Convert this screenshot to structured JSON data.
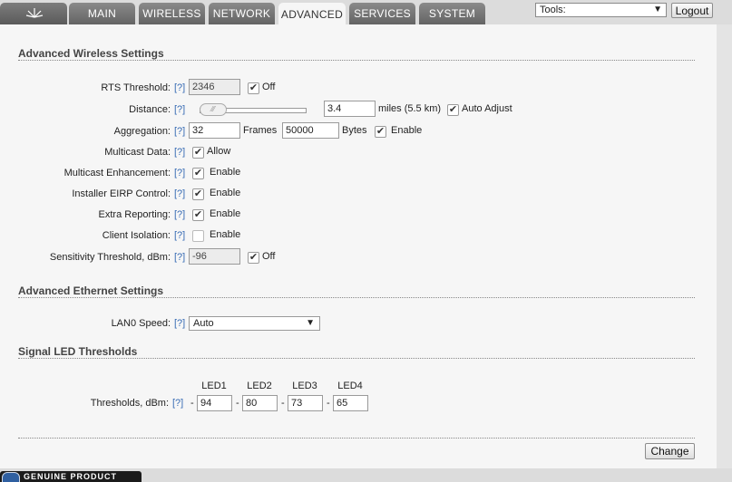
{
  "nav": {
    "tabs": [
      {
        "label": "MAIN"
      },
      {
        "label": "WIRELESS"
      },
      {
        "label": "NETWORK"
      },
      {
        "label": "ADVANCED"
      },
      {
        "label": "SERVICES"
      },
      {
        "label": "SYSTEM"
      }
    ],
    "active_tab": "ADVANCED",
    "tools_label": "Tools:",
    "logout_label": "Logout"
  },
  "help_marker": "[?]",
  "wireless": {
    "title": "Advanced Wireless Settings",
    "rts": {
      "label": "RTS Threshold:",
      "value": "2346",
      "off_label": "Off"
    },
    "distance": {
      "label": "Distance:",
      "value": "3.4",
      "unit": "miles (5.5 km)",
      "auto_label": "Auto Adjust"
    },
    "aggregation": {
      "label": "Aggregation:",
      "frames_value": "32",
      "frames_label": "Frames",
      "bytes_value": "50000",
      "bytes_label": "Bytes",
      "enable_label": "Enable"
    },
    "multicast_data": {
      "label": "Multicast Data:",
      "option": "Allow"
    },
    "multicast_enh": {
      "label": "Multicast Enhancement:",
      "option": "Enable"
    },
    "eirp": {
      "label": "Installer EIRP Control:",
      "option": "Enable"
    },
    "extra": {
      "label": "Extra Reporting:",
      "option": "Enable"
    },
    "isolation": {
      "label": "Client Isolation:",
      "option": "Enable"
    },
    "sensitivity": {
      "label": "Sensitivity Threshold, dBm:",
      "value": "-96",
      "off_label": "Off"
    }
  },
  "ethernet": {
    "title": "Advanced Ethernet Settings",
    "lan0": {
      "label": "LAN0 Speed:",
      "value": "Auto"
    }
  },
  "led": {
    "title": "Signal LED Thresholds",
    "headers": [
      "LED1",
      "LED2",
      "LED3",
      "LED4"
    ],
    "label": "Thresholds, dBm:",
    "dash": "-",
    "values": [
      "94",
      "80",
      "73",
      "65"
    ]
  },
  "change_label": "Change",
  "badge": {
    "text": "GENUINE PRODUCT"
  },
  "colors": {
    "accent": "#3a6db5",
    "tab_bg": "#6e6e6e",
    "panel_bg": "#f6f6f6"
  }
}
